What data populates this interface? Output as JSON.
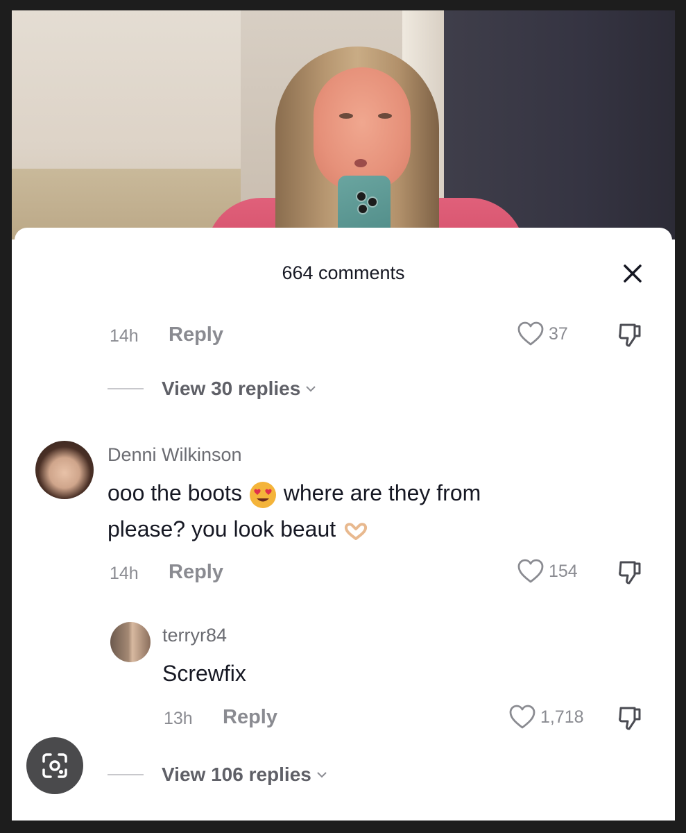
{
  "sheet": {
    "title": "664 comments"
  },
  "thread_top": {
    "time": "14h",
    "reply_label": "Reply",
    "likes": "37",
    "view_replies": "View 30 replies"
  },
  "comment_1": {
    "username": "Denni Wilkinson",
    "text_line1_a": "ooo the boots",
    "text_line1_b": "where are they from",
    "text_line2": "please? you look beaut",
    "time": "14h",
    "reply_label": "Reply",
    "likes": "154"
  },
  "reply_1": {
    "username": "terryr84",
    "text": "Screwfix",
    "time": "13h",
    "reply_label": "Reply",
    "likes": "1,718"
  },
  "thread_bottom": {
    "view_replies": "View 106 replies"
  },
  "icons": {
    "close": "close-icon",
    "like": "heart-outline-icon",
    "dislike": "thumbs-down-icon",
    "chevron": "chevron-down-icon",
    "lens": "google-lens-icon"
  },
  "colors": {
    "text_primary": "#161823",
    "text_secondary": "#8a8b91",
    "video_shirt": "#d4506b"
  }
}
